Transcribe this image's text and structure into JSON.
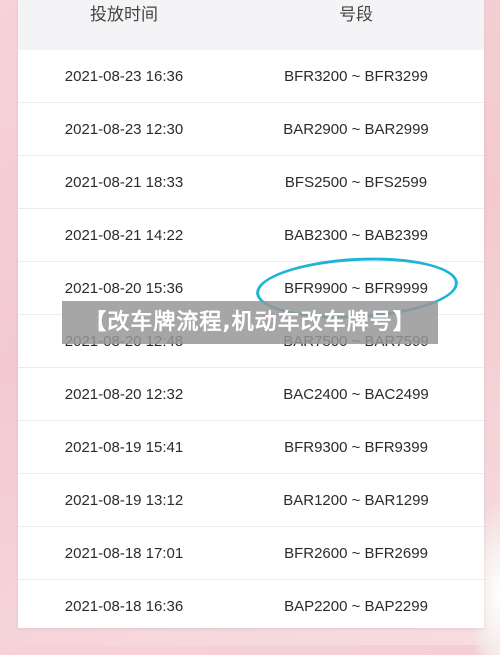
{
  "header": {
    "time_label": "投放时间",
    "range_label": "号段"
  },
  "rows": [
    {
      "time": "2021-08-23 16:36",
      "range": "BFR3200 ~ BFR3299"
    },
    {
      "time": "2021-08-23 12:30",
      "range": "BAR2900 ~ BAR2999"
    },
    {
      "time": "2021-08-21 18:33",
      "range": "BFS2500 ~ BFS2599"
    },
    {
      "time": "2021-08-21 14:22",
      "range": "BAB2300 ~ BAB2399"
    },
    {
      "time": "2021-08-20 15:36",
      "range": "BFR9900 ~ BFR9999"
    },
    {
      "time": "2021-08-20 12:48",
      "range": "BAR7500 ~ BAR7599"
    },
    {
      "time": "2021-08-20 12:32",
      "range": "BAC2400 ~ BAC2499"
    },
    {
      "time": "2021-08-19 15:41",
      "range": "BFR9300 ~ BFR9399"
    },
    {
      "time": "2021-08-19 13:12",
      "range": "BAR1200 ~ BAR1299"
    },
    {
      "time": "2021-08-18 17:01",
      "range": "BFR2600 ~ BFR2699"
    },
    {
      "time": "2021-08-18 16:36",
      "range": "BAP2200 ~ BAP2299"
    }
  ],
  "banner": {
    "text": "【改车牌流程,机动车改车牌号】"
  },
  "colors": {
    "highlight_circle": "#1fb3d6",
    "banner_bg": "#969696"
  }
}
